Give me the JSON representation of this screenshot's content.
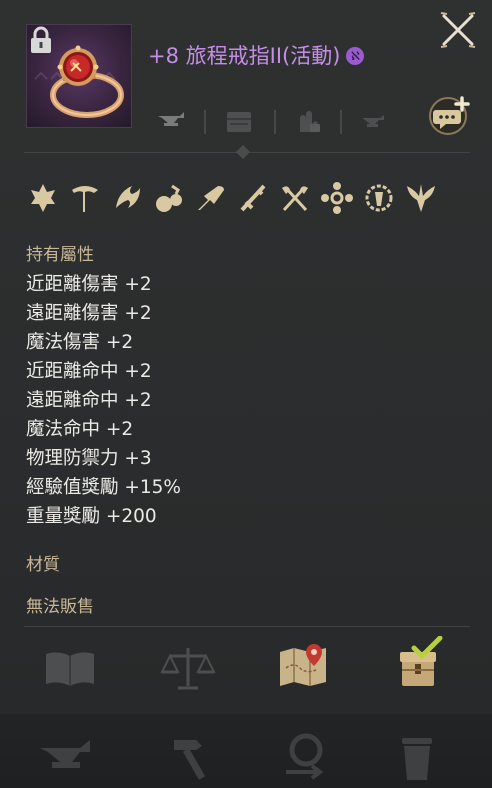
{
  "item": {
    "title": "+8 旅程戒指II(活動)",
    "badge_glyph": "ℵ",
    "title_color": "#c58de8",
    "locked": true
  },
  "icons": {
    "close": "close-icon",
    "chat_add": "chat-add-icon",
    "lock": "lock-icon",
    "top_tools": [
      "anvil-icon",
      "chest-icon",
      "hand-lock-icon",
      "anvil-small-icon"
    ],
    "classes": [
      "knight-class-icon",
      "warrior-class-icon",
      "mage-class-icon",
      "alchemist-class-icon",
      "dark-elf-class-icon",
      "lancer-class-icon",
      "berserker-class-icon",
      "monk-class-icon",
      "illusionist-class-icon",
      "elf-class-icon"
    ]
  },
  "sections": {
    "attributes_label": "持有屬性",
    "material_label": "材質",
    "unsellable_label": "無法販售"
  },
  "attributes": [
    "近距離傷害 +2",
    "遠距離傷害 +2",
    "魔法傷害 +2",
    "近距離命中 +2",
    "遠距離命中 +2",
    "魔法命中 +2",
    "物理防禦力 +3",
    "經驗值獎勵 +15%",
    "重量獎勵 +200"
  ],
  "actions": [
    "book-icon",
    "scale-icon",
    "map-pin-icon",
    "chest-check-icon"
  ],
  "footer": [
    "anvil-footer-icon",
    "hammer-icon",
    "magnifier-icon",
    "trash-icon"
  ],
  "colors": {
    "accent": "#c58de8",
    "section_label": "#c8b898",
    "background": "#2b2d2e"
  }
}
